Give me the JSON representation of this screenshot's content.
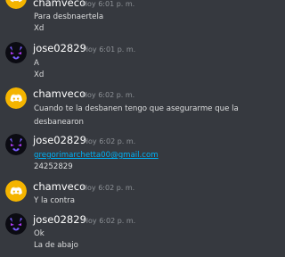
{
  "colors": {
    "background": "#36393f",
    "username": "#ffffff",
    "timestamp": "#8e9297",
    "message_text": "#dcddde",
    "link": "#00b0f4",
    "chamveco_avatar_bg": "#f4b400",
    "jose_avatar_bg": "#0b0b12",
    "jose_avatar_accent": "#7a5cff"
  },
  "messages": [
    {
      "author": "chamveco",
      "avatar": "discord-logo-icon",
      "timestamp": "Hoy 6:01 p. m.",
      "lines": [
        "Para desbnaertela",
        "Xd"
      ]
    },
    {
      "author": "jose02829",
      "avatar": "demon-face-icon",
      "timestamp": "Hoy 6:01 p. m.",
      "lines": [
        "A",
        "Xd"
      ]
    },
    {
      "author": "chamveco",
      "avatar": "discord-logo-icon",
      "timestamp": "Hoy 6:02 p. m.",
      "lines": [
        "Cuando te la desbanen tengo que asegurarme que la",
        "desbanearon"
      ]
    },
    {
      "author": "jose02829",
      "avatar": "demon-face-icon",
      "timestamp": "Hoy 6:02 p. m.",
      "link": "gregorimarchetta00@gmail.com",
      "lines": [
        "24252829"
      ]
    },
    {
      "author": "chamveco",
      "avatar": "discord-logo-icon",
      "timestamp": "Hoy 6:02 p. m.",
      "lines": [
        "Y la contra"
      ]
    },
    {
      "author": "jose02829",
      "avatar": "demon-face-icon",
      "timestamp": "Hoy 6:02 p. m.",
      "lines": [
        "Ok",
        "La de abajo"
      ]
    }
  ]
}
